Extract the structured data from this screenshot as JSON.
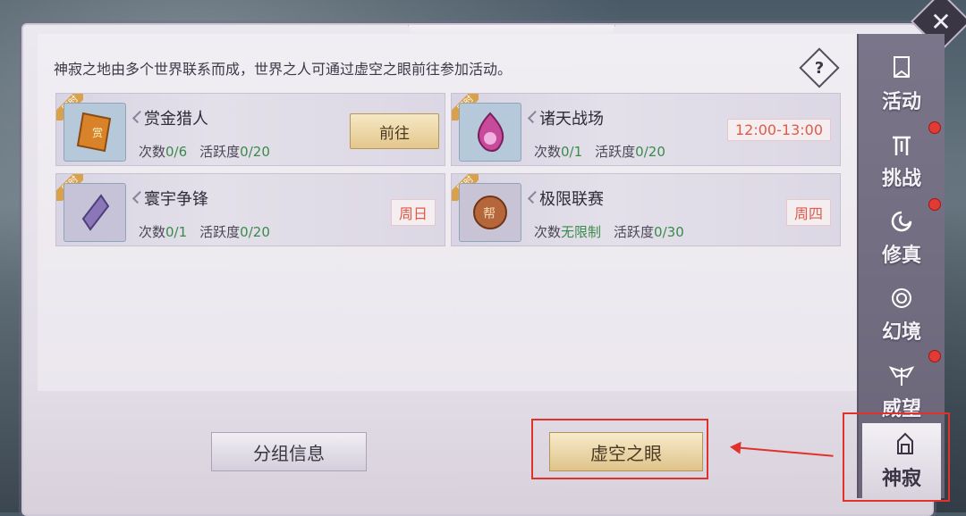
{
  "window": {
    "title": "神寂",
    "close_icon": "close-icon"
  },
  "description": "神寂之地由多个世界联系而成，世界之人可通过虚空之眼前往参加活动。",
  "help_symbol": "?",
  "activities": [
    {
      "tag": "限时",
      "name": "赏金猎人",
      "count_label": "次数",
      "count_value": "0/6",
      "active_label": "活跃度",
      "active_value": "0/20",
      "action": "前往",
      "icon": "bounty-scroll-icon"
    },
    {
      "tag": "限时",
      "name": "诸天战场",
      "count_label": "次数",
      "count_value": "0/1",
      "active_label": "活跃度",
      "active_value": "0/20",
      "time": "12:00-13:00",
      "icon": "flame-orb-icon"
    },
    {
      "tag": "限时",
      "name": "寰宇争锋",
      "count_label": "次数",
      "count_value": "0/1",
      "active_label": "活跃度",
      "active_value": "0/20",
      "day": "周日",
      "icon": "crystal-icon"
    },
    {
      "tag": "限时",
      "name": "极限联赛",
      "count_label": "次数",
      "count_value": "无限制",
      "active_label": "活跃度",
      "active_value": "0/30",
      "day": "周四",
      "icon": "seal-medal-icon"
    }
  ],
  "buttons": {
    "group_info": "分组信息",
    "void_eye": "虚空之眼"
  },
  "sidebar": {
    "items": [
      {
        "label": "活动",
        "icon": "banner-icon"
      },
      {
        "label": "挑战",
        "icon": "gate-icon"
      },
      {
        "label": "修真",
        "icon": "swirl-icon"
      },
      {
        "label": "幻境",
        "icon": "vortex-icon"
      },
      {
        "label": "威望",
        "icon": "wings-icon"
      },
      {
        "label": "神寂",
        "icon": "temple-icon"
      }
    ]
  },
  "colors": {
    "accent_red": "#e0322a",
    "value_green": "#3a8a4a",
    "time_red": "#e05a4a"
  }
}
